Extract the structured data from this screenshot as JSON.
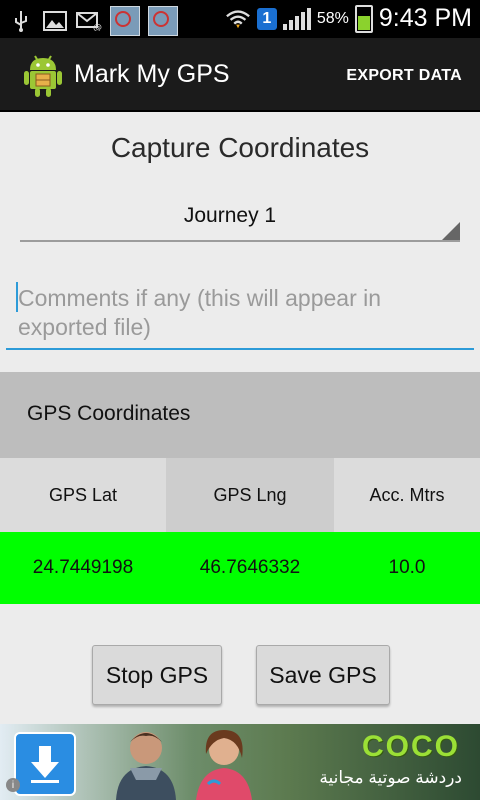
{
  "status_bar": {
    "time": "9:43 PM",
    "battery_text": "58%",
    "notification_badge": "1",
    "icons": [
      "usb-icon",
      "gallery-icon",
      "email-icon",
      "screenshot-thumbnail-icon",
      "screenshot-thumbnail-icon",
      "wifi-icon",
      "signal-icon",
      "battery-charging-icon"
    ]
  },
  "action_bar": {
    "title": "Mark My GPS",
    "export_label": "EXPORT DATA",
    "logo_icon": "android-app-icon"
  },
  "main": {
    "capture_title": "Capture Coordinates",
    "journey_selected": "Journey 1",
    "comments_placeholder": "Comments if any (this will appear in exported file)",
    "comments_value": ""
  },
  "gps": {
    "header": "GPS Coordinates",
    "columns": [
      "GPS Lat",
      "GPS Lng",
      "Acc. Mtrs"
    ],
    "values": [
      "24.7449198",
      "46.7646332",
      "10.0"
    ],
    "values_bg_color": "#00ff00"
  },
  "buttons": {
    "stop_label": "Stop GPS",
    "save_label": "Save GPS"
  },
  "ad": {
    "brand": "COCO",
    "tagline": "دردشة صوتية مجانية",
    "icon": "download-icon"
  }
}
